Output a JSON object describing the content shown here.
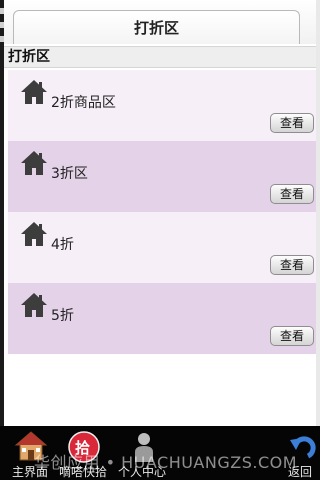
{
  "header": {
    "title": "打折区"
  },
  "section": {
    "title": "打折区"
  },
  "list": {
    "items": [
      {
        "label": "2折商品区",
        "button": "查看"
      },
      {
        "label": "3折区",
        "button": "查看"
      },
      {
        "label": "4折",
        "button": "查看"
      },
      {
        "label": "5折",
        "button": "查看"
      }
    ]
  },
  "tabbar": {
    "items": [
      {
        "label": "主界面",
        "icon": "house-icon"
      },
      {
        "label": "嘀嗒快拾",
        "icon": "grab-icon"
      },
      {
        "label": "个人中心",
        "icon": "person-icon"
      },
      {
        "label": "返回",
        "icon": "back-arrow-icon"
      }
    ],
    "grab_glyph": "拾"
  },
  "watermark": {
    "text": "华创应用 • HUACHUANGZS.COM"
  },
  "colors": {
    "row_odd": "#f6eff8",
    "row_even": "#e4d3e8",
    "tabbar_bg": "#050505",
    "grab_red": "#d8283a"
  }
}
